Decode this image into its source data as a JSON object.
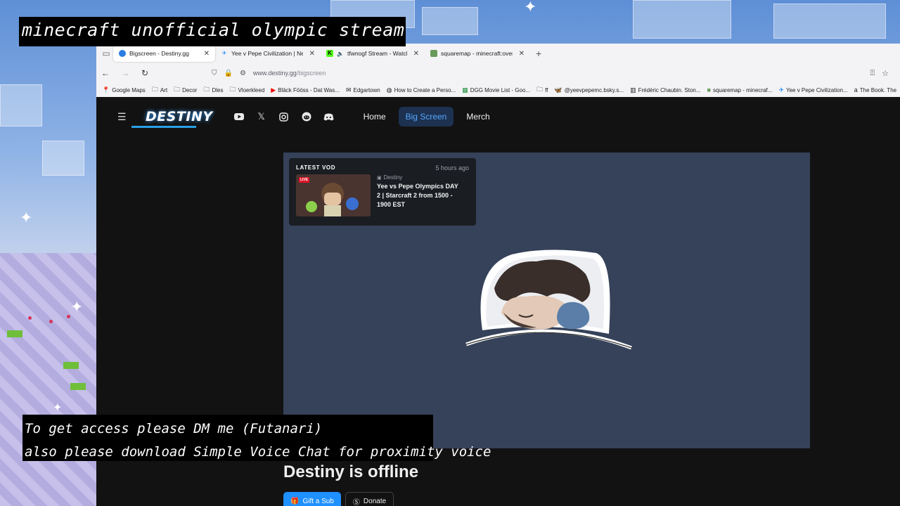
{
  "overlay": {
    "top_caption": "minecraft unofficial olympic stream",
    "bottom_line1": "To get access please DM me (Futanari)",
    "bottom_line2": "also please download Simple Voice Chat for proximity voice"
  },
  "browser": {
    "tabs": [
      {
        "title": "Bigscreen - Destiny.gg",
        "active": true,
        "icon": "destiny-favicon"
      },
      {
        "title": "Yee v Pepe Civilization | Networ",
        "active": false,
        "icon": "bluesky-favicon"
      },
      {
        "title": "tfwnogf Stream - Watch Liv",
        "active": false,
        "icon": "kick-favicon",
        "muted": true
      },
      {
        "title": "squaremap - minecraft:overwor",
        "active": false,
        "icon": "squaremap-favicon"
      }
    ],
    "url_host": "www.destiny.gg",
    "url_path": "/bigscreen",
    "bookmarks": [
      {
        "label": "Google Maps",
        "icon": "map-pin-icon"
      },
      {
        "label": "Art",
        "icon": "folder-icon"
      },
      {
        "label": "Decor",
        "icon": "folder-icon"
      },
      {
        "label": "Dles",
        "icon": "folder-icon"
      },
      {
        "label": "Vloerkleed",
        "icon": "folder-icon"
      },
      {
        "label": "Blāck Fööss - Dat Was...",
        "icon": "youtube-icon"
      },
      {
        "label": "Edgartown",
        "icon": "envelope-icon"
      },
      {
        "label": "How to Create a Perso...",
        "icon": "globe-icon"
      },
      {
        "label": "DGG Movie List - Goo...",
        "icon": "sheets-icon"
      },
      {
        "label": "ff",
        "icon": "folder-icon"
      },
      {
        "label": "@yeevpepemc.bsky.s...",
        "icon": "bluesky-icon"
      },
      {
        "label": "Frédéric Chaubin. Ston...",
        "icon": "book-icon"
      },
      {
        "label": "squaremap - minecraf...",
        "icon": "squaremap-icon"
      },
      {
        "label": "Yee v Pepe Civilization...",
        "icon": "bluesky-icon"
      },
      {
        "label": "The Book. The",
        "icon": "amazon-icon"
      }
    ]
  },
  "site": {
    "logo": "DESTINY",
    "nav": [
      {
        "label": "Home",
        "active": false
      },
      {
        "label": "Big Screen",
        "active": true
      },
      {
        "label": "Merch",
        "active": false
      }
    ],
    "socials": [
      "youtube-icon",
      "x-icon",
      "instagram-icon",
      "reddit-icon",
      "discord-icon"
    ],
    "latest_vod": {
      "label": "LATEST VOD",
      "time": "5 hours ago",
      "live_badge": "LIVE",
      "channel": "Destiny",
      "title": "Yee vs Pepe Olympics DAY 2 | Starcraft 2 from 1500 - 1900 EST"
    },
    "offline_text": "Destiny is offline",
    "buttons": {
      "gift": "Gift a Sub",
      "donate": "Donate"
    }
  }
}
